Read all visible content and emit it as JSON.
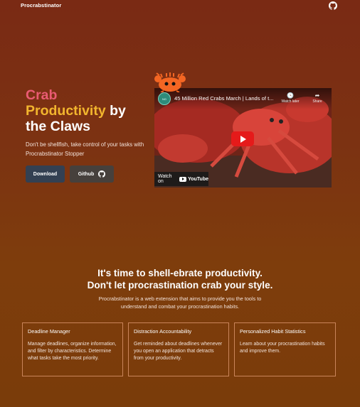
{
  "nav": {
    "brand": "Procrabstinator",
    "github_icon": "github-icon"
  },
  "hero": {
    "title_line1": "Crab",
    "title_line2a": "Productivity",
    "title_line2b": " by",
    "title_line3": "the Claws",
    "subtitle": "Don't be shellfish, take control of your tasks with Procrabstinator Stopper",
    "download_label": "Download",
    "github_label": "Github"
  },
  "video": {
    "title": "45 Million Red Crabs March | Lands of t...",
    "watch_later": "Watch later",
    "share": "Share",
    "watch_on": "Watch on",
    "youtube": "YouTube"
  },
  "section": {
    "title_line1": "It's time to shell-ebrate productivity.",
    "title_line2": "Don't let procrastination crab your style.",
    "subtitle": "Procrabstinator is a web extension that aims to provide you the tools to understand and combat your procrastination habits."
  },
  "features": [
    {
      "title": "Deadline Manager",
      "body": "Manage deadlines, organize information, and filter by characteristics. Determine what tasks take the most priority."
    },
    {
      "title": "Distraction Accountability",
      "body": "Get reminded about deadlines whenever you open an application that detracts from your productivity."
    },
    {
      "title": "Personalized Habit Statistics",
      "body": "Learn about your procrastination habits and improve them."
    }
  ],
  "colors": {
    "accent_pink": "#ea5b73",
    "accent_gold": "#f2b52e",
    "btn_download": "#334052",
    "btn_github": "#46403c"
  }
}
